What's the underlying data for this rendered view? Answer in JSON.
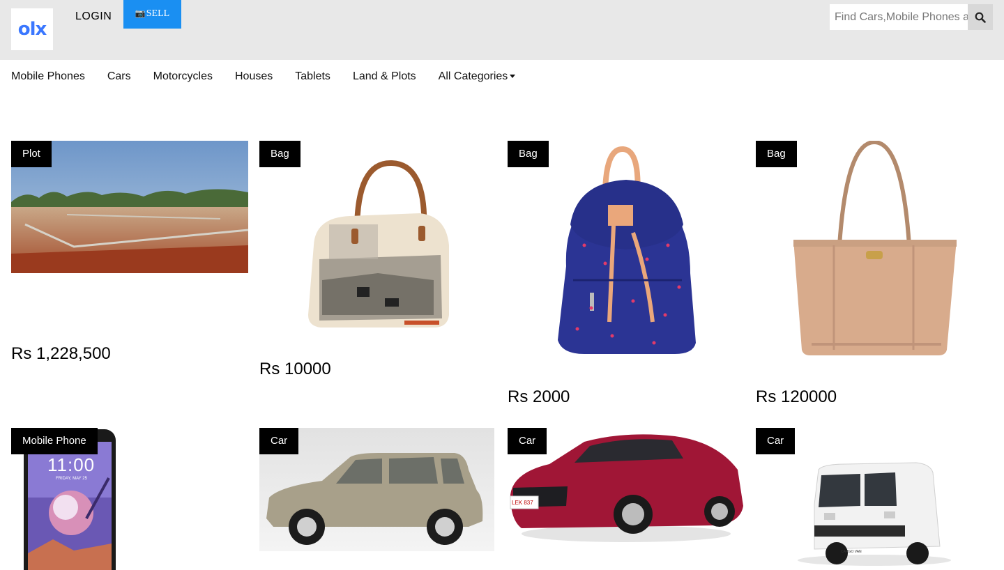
{
  "header": {
    "logo_text": "olx",
    "login_label": "LOGIN",
    "sell_label": "SELL",
    "search_placeholder": "Find Cars,Mobile Phones and more..."
  },
  "nav": {
    "items": [
      "Mobile Phones",
      "Cars",
      "Motorcycles",
      "Houses",
      "Tablets",
      "Land & Plots",
      "All Categories"
    ]
  },
  "listings": [
    {
      "tag": "Plot",
      "price": "Rs 1,228,500"
    },
    {
      "tag": "Bag",
      "price": "Rs 10000"
    },
    {
      "tag": "Bag",
      "price": "Rs 2000"
    },
    {
      "tag": "Bag",
      "price": "Rs 120000"
    },
    {
      "tag": "Mobile Phone",
      "time": "11:00",
      "date": "FRIDAY, MAY 25"
    },
    {
      "tag": "Car"
    },
    {
      "tag": "Car",
      "plate": "LEK 837"
    },
    {
      "tag": "Car",
      "badge": "CARGO VAN"
    }
  ],
  "colors": {
    "header_bg": "#e8e8e8",
    "sell_bg": "#1a8ff2",
    "logo_blue": "#3a77ff",
    "tag_bg": "#000000"
  }
}
